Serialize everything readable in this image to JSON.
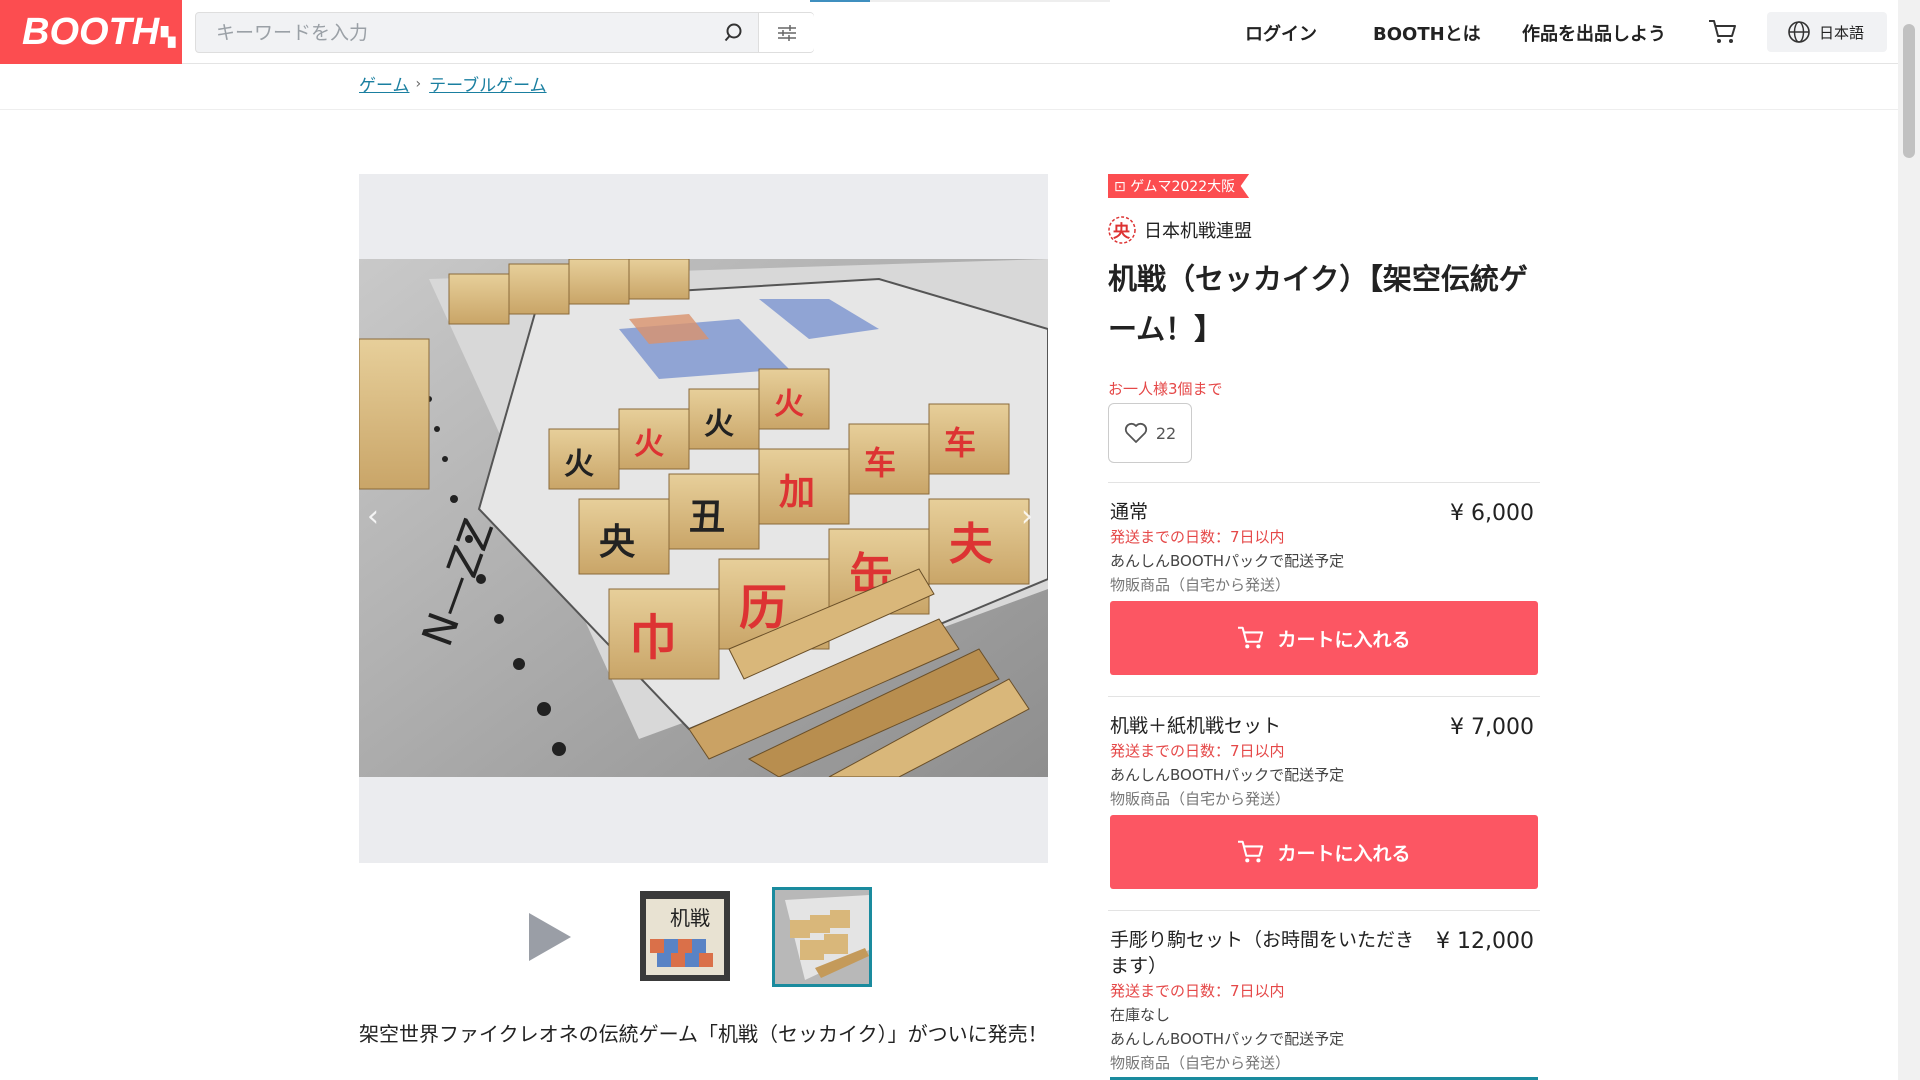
{
  "header": {
    "logo": "BOOTH",
    "search_placeholder": "キーワードを入力",
    "nav": {
      "login": "ログイン",
      "about": "BOOTHとは",
      "sell": "作品を出品しよう"
    },
    "language": "日本語"
  },
  "breadcrumb": [
    "ゲーム",
    "テーブルゲーム"
  ],
  "gallery": {
    "prev": "‹",
    "next": "›"
  },
  "description": "架空世界ファイクレオネの伝統ゲーム「机戦（セッカイク）」がついに発売！",
  "product": {
    "event_tag": "ゲムマ2022大阪",
    "shop_name": "日本机戦連盟",
    "title": "机戦（セッカイク）【架空伝統ゲーム！】",
    "purchase_limit": "お一人様3個まで",
    "likes": "22",
    "cart_label": "カートに入れる",
    "variants": [
      {
        "name": "通常",
        "price": "¥ 6,000",
        "shipping": "発送までの日数：7日以内",
        "pack": "あんしんBOOTHパックで配送予定",
        "type": "物販商品（自宅から発送）"
      },
      {
        "name": "机戦＋紙机戦セット",
        "price": "¥ 7,000",
        "shipping": "発送までの日数：7日以内",
        "pack": "あんしんBOOTHパックで配送予定",
        "type": "物販商品（自宅から発送）"
      },
      {
        "name": "手彫り駒セット（お時間をいただきます）",
        "price": "¥ 12,000",
        "shipping": "発送までの日数：7日以内",
        "stock": "在庫なし",
        "pack": "あんしんBOOTHパックで配送予定",
        "type": "物販商品（自宅から発送）"
      }
    ]
  },
  "colors": {
    "brand": "#fc4d50",
    "cart_button": "#fc5663",
    "link": "#1a7fa0",
    "alert": "#e54848"
  }
}
